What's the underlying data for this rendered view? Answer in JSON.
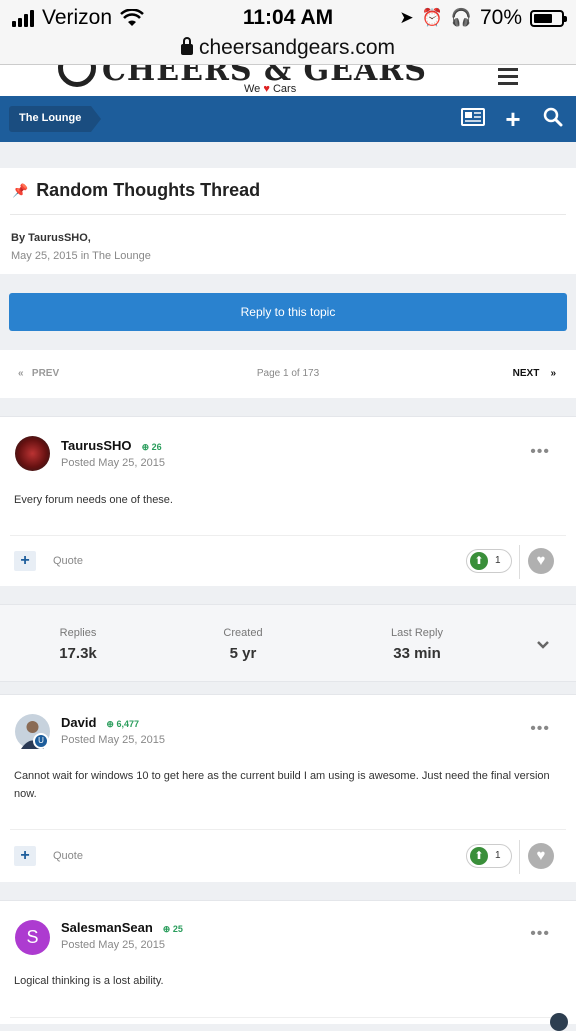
{
  "status_bar": {
    "carrier": "Verizon",
    "time": "11:04 AM",
    "battery": "70%",
    "battery_level": 0.7
  },
  "browser": {
    "url": "cheersandgears.com"
  },
  "site": {
    "logo_text": "CHEERS & GEARS",
    "tagline_pre": "We",
    "tagline_post": "Cars"
  },
  "nav": {
    "breadcrumb": "The Lounge",
    "icons": [
      "newspaper-icon",
      "plus-icon",
      "search-icon"
    ]
  },
  "thread": {
    "title": "Random Thoughts Thread",
    "by": "By TaurusSHO,",
    "date_line": "May 25, 2015 in The Lounge",
    "reply_button": "Reply to this topic"
  },
  "pagination": {
    "prev": "PREV",
    "page_info": "Page 1 of 173",
    "next": "NEXT"
  },
  "stats": {
    "replies_label": "Replies",
    "replies_value": "17.3k",
    "created_label": "Created",
    "created_value": "5 yr",
    "last_reply_label": "Last Reply",
    "last_reply_value": "33 min"
  },
  "posts": [
    {
      "author": "TaurusSHO",
      "rep": "26",
      "posted": "Posted May 25, 2015",
      "content": "Every forum needs one of these.",
      "quote_label": "Quote",
      "reactions": "1"
    },
    {
      "author": "David",
      "rep": "6,477",
      "posted": "Posted May 25, 2015",
      "content": "Cannot wait for windows 10 to get here as the current build I am using is awesome. Just need the final version now.",
      "quote_label": "Quote",
      "reactions": "1"
    },
    {
      "author": "SalesmanSean",
      "avatar_letter": "S",
      "rep": "25",
      "posted": "Posted May 25, 2015",
      "content": "Logical thinking is a lost ability."
    }
  ],
  "colors": {
    "nav_blue": "#1d5d9b",
    "button_blue": "#2a82cf",
    "rep_green": "#2a9d5c"
  }
}
